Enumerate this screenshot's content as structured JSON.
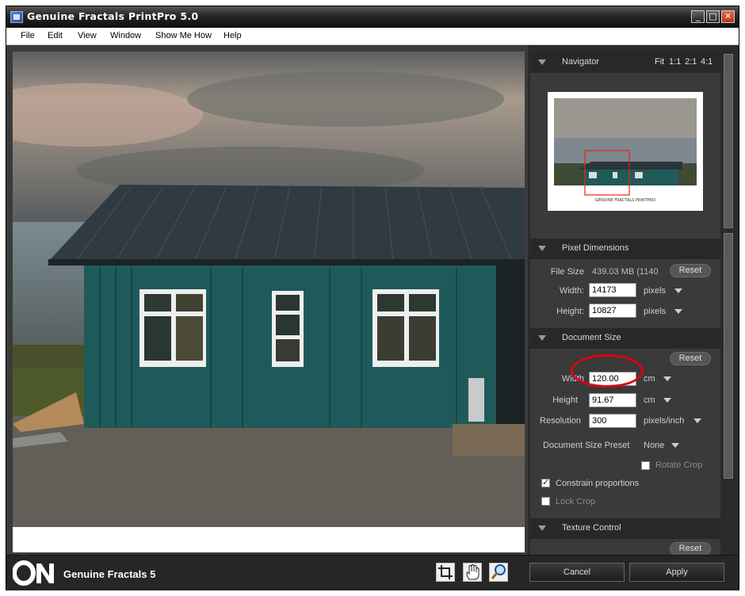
{
  "window": {
    "title": "Genuine Fractals PrintPro 5.0",
    "min_label": "_",
    "max_label": "□",
    "close_label": "✕"
  },
  "menu": [
    "File",
    "Edit",
    "View",
    "Window",
    "Show Me How",
    "Help"
  ],
  "navigator": {
    "label": "Navigator",
    "zoom_options": [
      "Fit",
      "1:1",
      "2:1",
      "4:1"
    ],
    "thumb_caption": "GENUINE FRACTALS PRINTPRO"
  },
  "pixel_dimensions": {
    "label": "Pixel Dimensions",
    "file_size_label": "File Size",
    "file_size_value": "439.03  MB (1140",
    "reset_label": "Reset",
    "width_label": "Width:",
    "width_value": "14173",
    "width_unit": "pixels",
    "height_label": "Height:",
    "height_value": "10827",
    "height_unit": "pixels"
  },
  "document_size": {
    "label": "Document Size",
    "reset_label": "Reset",
    "width_label": "Width",
    "width_value": "120.00",
    "width_unit": "cm",
    "height_label": "Height",
    "height_value": "91.67",
    "height_unit": "cm",
    "resolution_label": "Resolution",
    "resolution_value": "300",
    "resolution_unit": "pixels/inch",
    "preset_label": "Document Size Preset",
    "preset_value": "None",
    "rotate_crop_label": "Rotate Crop",
    "constrain_label": "Constrain proportions",
    "constrain_checked": true,
    "lock_crop_label": "Lock Crop",
    "lock_crop_checked": false
  },
  "texture_control": {
    "label": "Texture Control",
    "reset_label": "Reset"
  },
  "bottom": {
    "brand": "Genuine Fractals 5",
    "logo_text": "ON",
    "cancel_label": "Cancel",
    "apply_label": "Apply"
  }
}
